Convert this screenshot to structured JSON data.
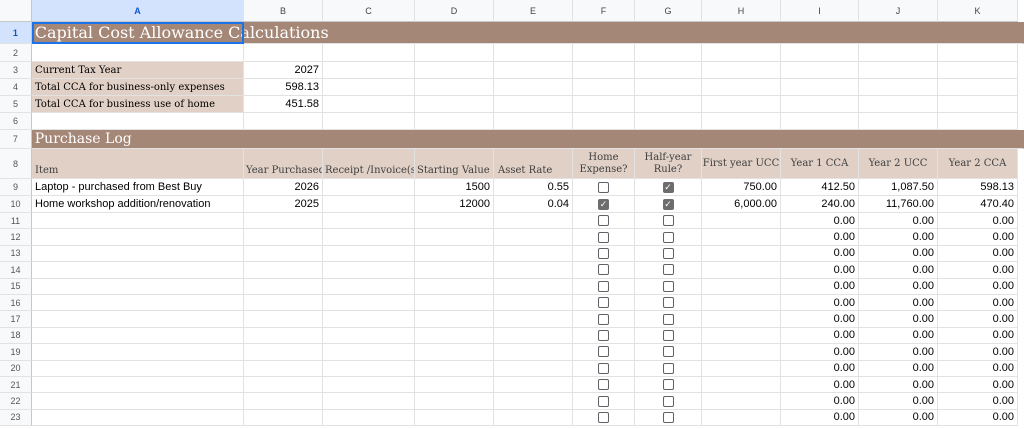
{
  "columns": [
    "A",
    "B",
    "C",
    "D",
    "E",
    "F",
    "G",
    "H",
    "I",
    "J",
    "K"
  ],
  "title": "Capital Cost Allowance Calculations",
  "summary": [
    {
      "label": "Current Tax Year",
      "value": "2027"
    },
    {
      "label": "Total CCA for business-only expenses",
      "value": "598.13"
    },
    {
      "label": "Total CCA for business use of home",
      "value": "451.58"
    }
  ],
  "log_title": "Purchase Log",
  "headers": {
    "item": "Item",
    "year_purchased": "Year Purchased",
    "receipt": "Receipt /Invoice(s)",
    "starting_value": "Starting Value",
    "asset_rate": "Asset Rate",
    "home_expense": "Home Expense?",
    "half_year": "Half-year Rule?",
    "first_year_ucc": "First year UCC",
    "year1_cca": "Year 1 CCA",
    "year2_ucc": "Year 2 UCC",
    "year2_cca": "Year 2 CCA"
  },
  "purchases": [
    {
      "item": "Laptop - purchased from Best Buy",
      "year": "2026",
      "receipt": "",
      "start": "1500",
      "rate": "0.55",
      "home": false,
      "half": true,
      "fyucc": "750.00",
      "y1cca": "412.50",
      "y2ucc": "1,087.50",
      "y2cca": "598.13"
    },
    {
      "item": "Home workshop addition/renovation",
      "year": "2025",
      "receipt": "",
      "start": "12000",
      "rate": "0.04",
      "home": true,
      "half": true,
      "fyucc": "6,000.00",
      "y1cca": "240.00",
      "y2ucc": "11,760.00",
      "y2cca": "470.40"
    }
  ],
  "empty_rows": [
    "11",
    "12",
    "13",
    "14",
    "15",
    "16",
    "17",
    "18",
    "19",
    "20",
    "21",
    "22",
    "23"
  ],
  "empty_value": "0.00",
  "row_numbers": {
    "r1": "1",
    "r2": "2",
    "r3": "3",
    "r4": "4",
    "r5": "5",
    "r6": "6",
    "r7": "7",
    "r8": "8",
    "r9": "9",
    "r10": "10"
  }
}
